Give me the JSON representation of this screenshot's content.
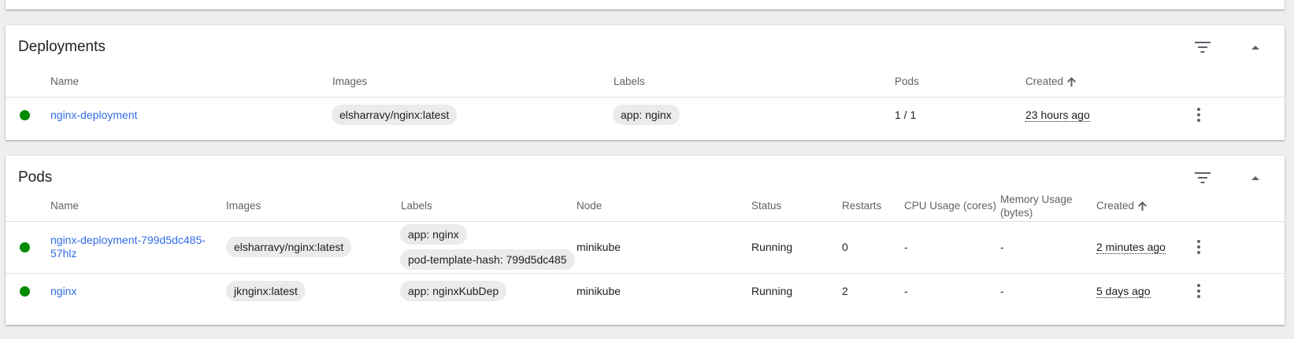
{
  "deployments": {
    "title": "Deployments",
    "columns": {
      "name": "Name",
      "images": "Images",
      "labels": "Labels",
      "pods": "Pods",
      "created": "Created"
    },
    "rows": [
      {
        "status": "running",
        "name": "nginx-deployment",
        "image": "elsharravy/nginx:latest",
        "label": "app: nginx",
        "pods": "1 / 1",
        "created": "23 hours ago"
      }
    ]
  },
  "pods": {
    "title": "Pods",
    "columns": {
      "name": "Name",
      "images": "Images",
      "labels": "Labels",
      "node": "Node",
      "status": "Status",
      "restarts": "Restarts",
      "cpu": "CPU Usage (cores)",
      "memory": "Memory Usage (bytes)",
      "created": "Created"
    },
    "rows": [
      {
        "name": "nginx-deployment-799d5dc485-57hlz",
        "image": "elsharravy/nginx:latest",
        "labels": [
          "app: nginx",
          "pod-template-hash: 799d5dc485"
        ],
        "node": "minikube",
        "status": "Running",
        "restarts": "0",
        "cpu": "-",
        "memory": "-",
        "created": "2 minutes ago"
      },
      {
        "name": "nginx",
        "image": "jknginx:latest",
        "labels": [
          "app: nginxKubDep"
        ],
        "node": "minikube",
        "status": "Running",
        "restarts": "2",
        "cpu": "-",
        "memory": "-",
        "created": "5 days ago"
      }
    ]
  },
  "colors": {
    "status_ok": "#008a00",
    "link": "#326de6",
    "chip_bg": "#ebebeb"
  },
  "icons": {
    "filter": "filter-list-icon",
    "collapse": "expand-less-icon",
    "menu": "more-vert-icon",
    "sort": "arrow-upward-icon"
  }
}
